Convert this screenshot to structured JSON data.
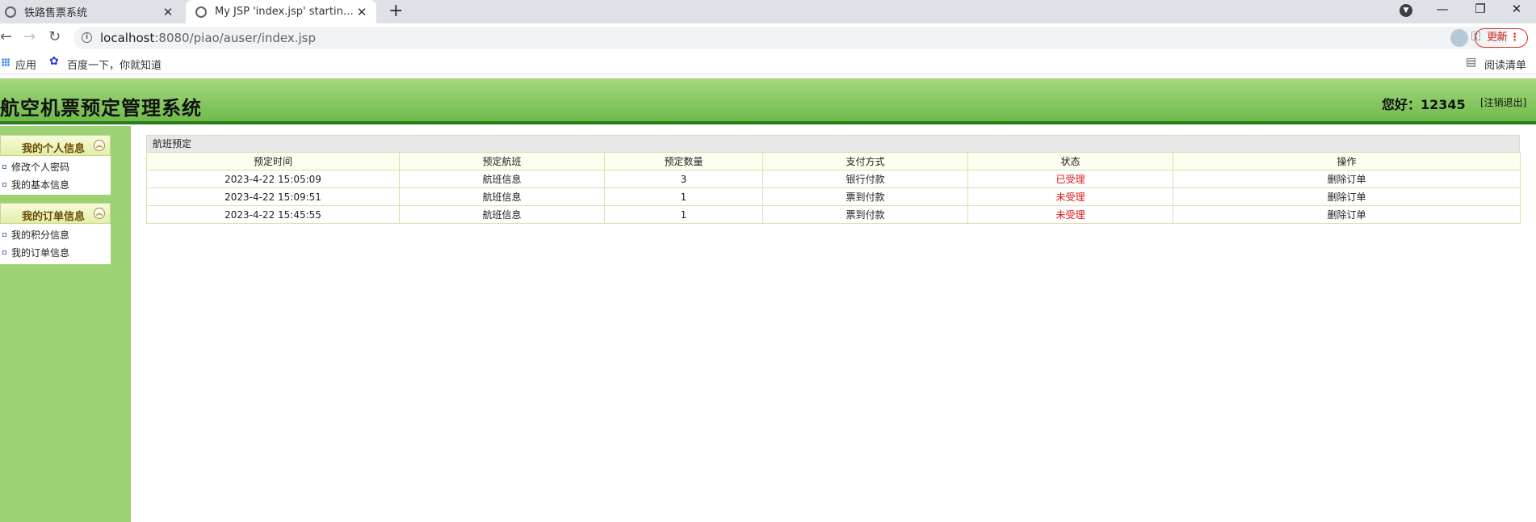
{
  "browser": {
    "tabs": [
      {
        "title": "铁路售票系统"
      },
      {
        "title": "My JSP 'index.jsp' starting page"
      }
    ],
    "url_host": "localhost",
    "url_rest": ":8080/piao/auser/index.jsp",
    "update_label": "更新",
    "bookmarks": {
      "apps": "应用",
      "baidu": "百度一下，你就知道",
      "reading_list": "阅读清单"
    }
  },
  "header": {
    "title": "航空机票预定管理系统",
    "greeting": "您好：12345",
    "logout": "[注销退出]",
    "accent_color": "#6fbb4a"
  },
  "sidebar": {
    "panels": [
      {
        "title": "我的个人信息",
        "items": [
          "修改个人密码",
          "我的基本信息"
        ]
      },
      {
        "title": "我的订单信息",
        "items": [
          "我的积分信息",
          "我的订单信息"
        ]
      }
    ]
  },
  "main": {
    "caption": "航班预定",
    "columns": [
      "预定时间",
      "预定航班",
      "预定数量",
      "支付方式",
      "状态",
      "操作"
    ],
    "rows": [
      [
        "2023-4-22 15:05:09",
        "航班信息",
        "3",
        "银行付款",
        "已受理",
        "删除订单"
      ],
      [
        "2023-4-22 15:09:51",
        "航班信息",
        "1",
        "票到付款",
        "未受理",
        "删除订单"
      ],
      [
        "2023-4-22 15:45:55",
        "航班信息",
        "1",
        "票到付款",
        "未受理",
        "删除订单"
      ]
    ],
    "status_color": "#e21111"
  }
}
